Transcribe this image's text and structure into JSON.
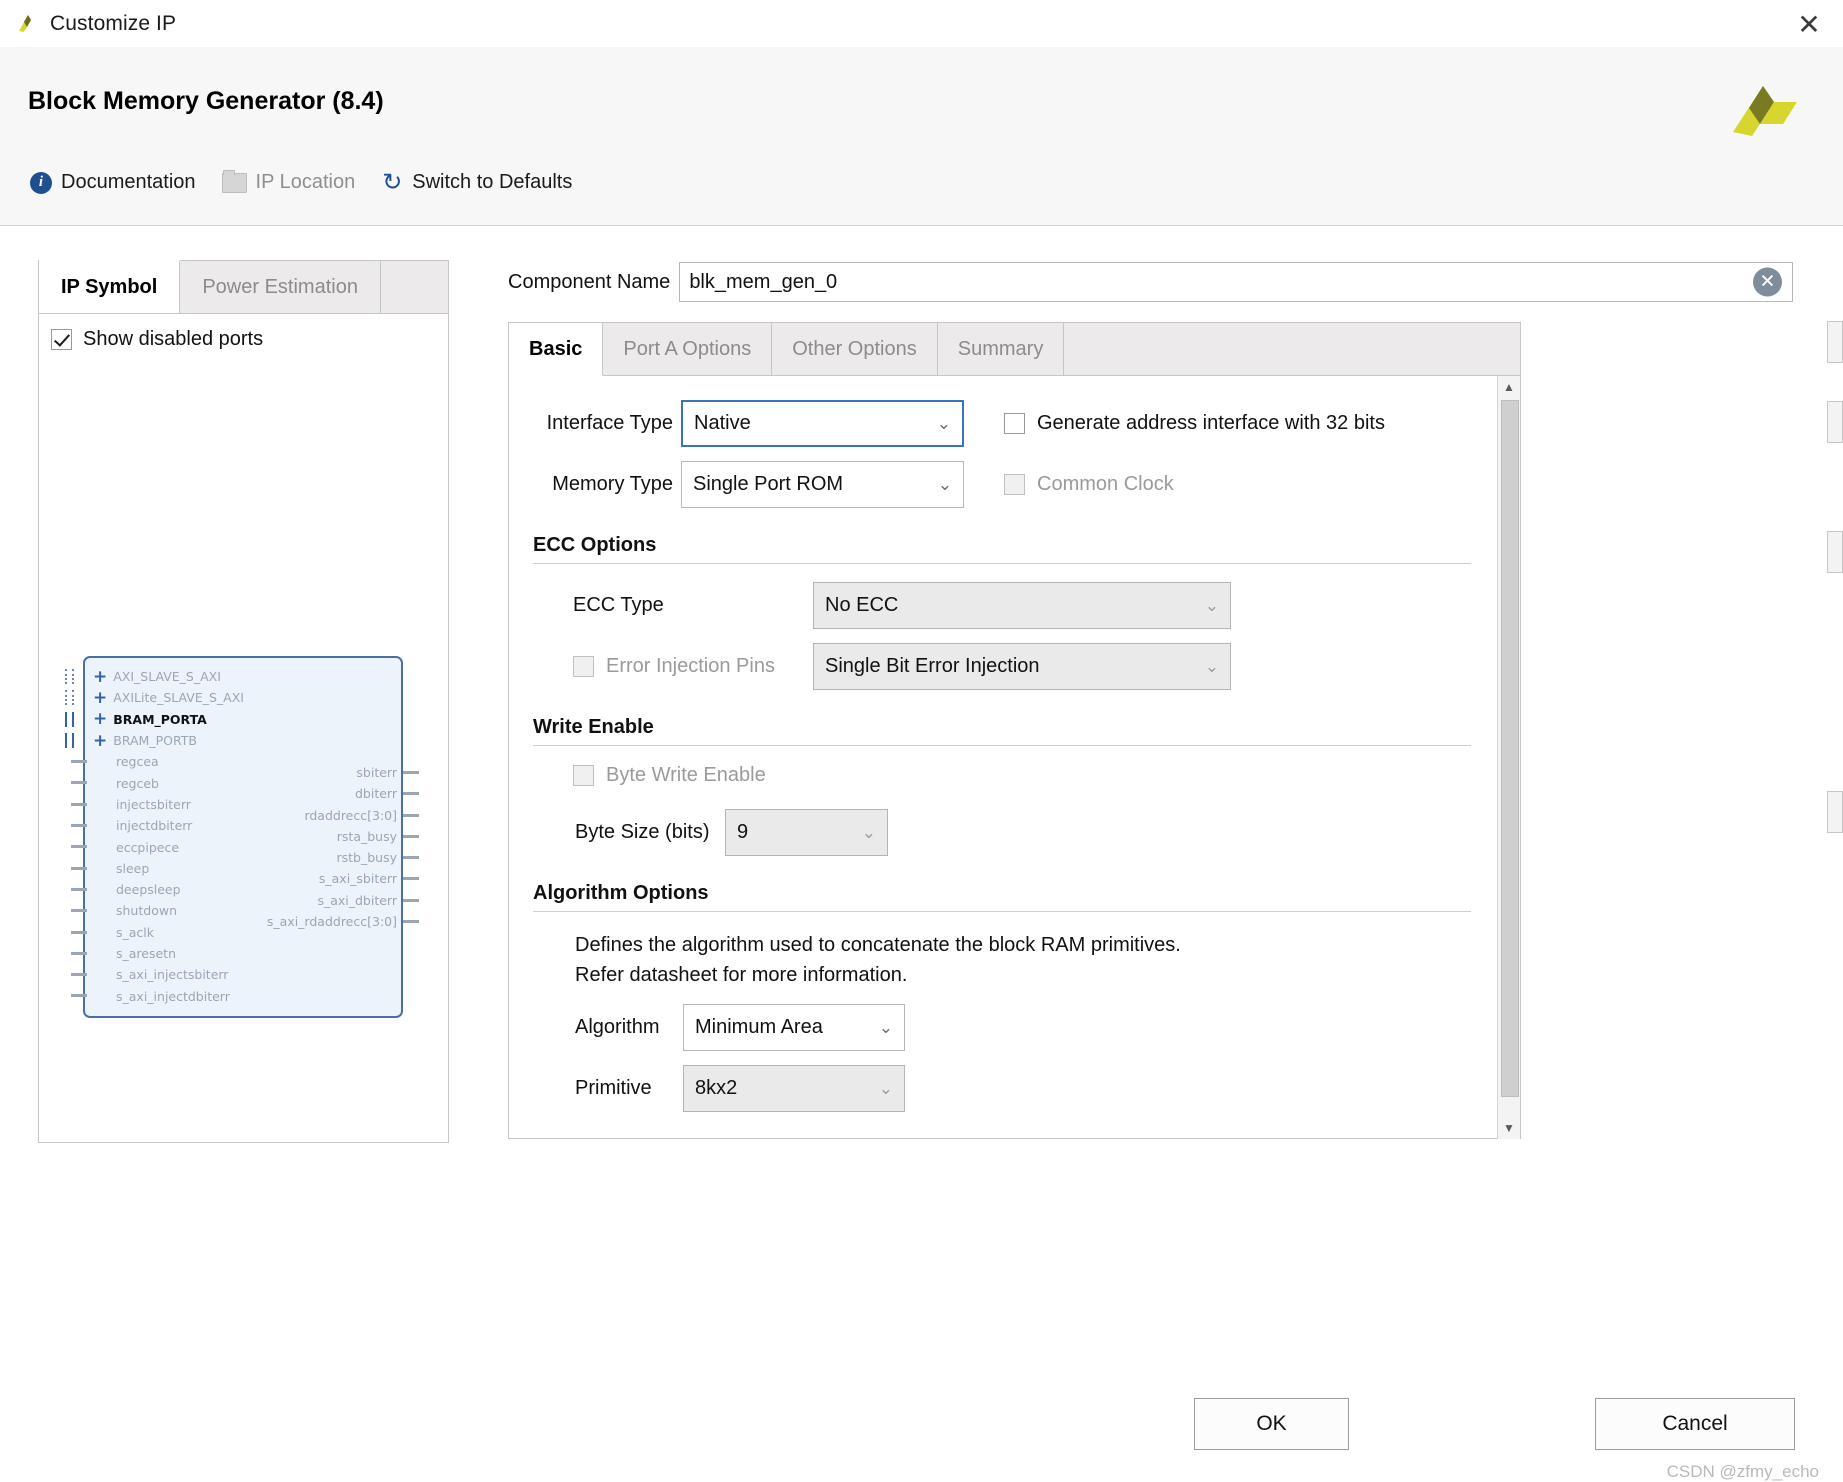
{
  "window": {
    "title": "Customize IP",
    "close_label": "✕",
    "logo_name": "xilinx-logo"
  },
  "header": {
    "title": "Block Memory Generator (8.4)",
    "links": [
      {
        "label": "Documentation",
        "icon": "info-icon",
        "dim": false
      },
      {
        "label": "IP Location",
        "icon": "folder-icon",
        "dim": true
      },
      {
        "label": "Switch to Defaults",
        "icon": "refresh-icon",
        "dim": false
      }
    ]
  },
  "left_panel": {
    "tabs": [
      {
        "label": "IP Symbol",
        "active": true
      },
      {
        "label": "Power Estimation",
        "active": false
      }
    ],
    "show_disabled_ports": {
      "label": "Show disabled ports",
      "checked": true
    },
    "symbol": {
      "bus_ports": [
        {
          "label": "AXI_SLAVE_S_AXI",
          "bold": false,
          "stub": "dotted"
        },
        {
          "label": "AXILite_SLAVE_S_AXI",
          "bold": false,
          "stub": "dotted"
        },
        {
          "label": "BRAM_PORTA",
          "bold": true,
          "stub": "solid"
        },
        {
          "label": "BRAM_PORTB",
          "bold": false,
          "stub": "solid"
        }
      ],
      "left_ports": [
        "regcea",
        "regceb",
        "injectsbiterr",
        "injectdbiterr",
        "eccpipece",
        "sleep",
        "deepsleep",
        "shutdown",
        "s_aclk",
        "s_aresetn",
        "s_axi_injectsbiterr",
        "s_axi_injectdbiterr"
      ],
      "right_ports": [
        "sbiterr",
        "dbiterr",
        "rdaddrecc[3:0]",
        "rsta_busy",
        "rstb_busy",
        "s_axi_sbiterr",
        "s_axi_dbiterr",
        "s_axi_rdaddrecc[3:0]"
      ]
    }
  },
  "main": {
    "component_name": {
      "label": "Component Name",
      "value": "blk_mem_gen_0",
      "clear_icon": "clear-icon"
    },
    "tabs": [
      {
        "label": "Basic",
        "active": true
      },
      {
        "label": "Port A Options",
        "active": false
      },
      {
        "label": "Other Options",
        "active": false
      },
      {
        "label": "Summary",
        "active": false
      }
    ],
    "basic": {
      "interface_type": {
        "label": "Interface Type",
        "value": "Native",
        "focused": true,
        "disabled": false
      },
      "memory_type": {
        "label": "Memory Type",
        "value": "Single Port ROM",
        "focused": false,
        "disabled": false
      },
      "generate_address_interface": {
        "label": "Generate address interface with 32 bits",
        "checked": false,
        "disabled": false
      },
      "common_clock": {
        "label": "Common Clock",
        "checked": false,
        "disabled": true
      },
      "ecc_options": {
        "title": "ECC Options",
        "ecc_type": {
          "label": "ECC Type",
          "value": "No ECC",
          "disabled": true
        },
        "error_injection_pins": {
          "label": "Error Injection Pins",
          "checked": false,
          "disabled": true,
          "value": "Single Bit Error Injection"
        }
      },
      "write_enable": {
        "title": "Write Enable",
        "byte_write_enable": {
          "label": "Byte Write Enable",
          "checked": false,
          "disabled": true
        },
        "byte_size": {
          "label": "Byte Size (bits)",
          "value": "9",
          "disabled": true
        }
      },
      "algorithm_options": {
        "title": "Algorithm Options",
        "description_line1": "Defines the algorithm used to concatenate the block RAM primitives.",
        "description_line2": "Refer datasheet for more information.",
        "algorithm": {
          "label": "Algorithm",
          "value": "Minimum Area",
          "disabled": false
        },
        "primitive": {
          "label": "Primitive",
          "value": "8kx2",
          "disabled": true
        }
      }
    },
    "scrollbar": {
      "up_arrow": "▲",
      "down_arrow": "▼"
    }
  },
  "footer": {
    "ok_label": "OK",
    "cancel_label": "Cancel",
    "watermark": "CSDN @zfmy_echo"
  }
}
